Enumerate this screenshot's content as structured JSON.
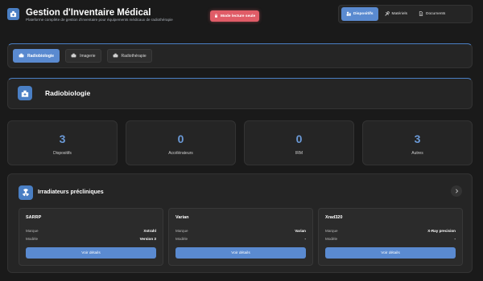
{
  "header": {
    "title": "Gestion d'Inventaire Médical",
    "subtitle": "Plateforme complète de gestion d'inventaire pour équipements médicaux de radiothérapie",
    "readonly_badge": "Mode lecture seule"
  },
  "topnav": {
    "tabs": [
      {
        "label": "Dispositifs",
        "icon": "devices-icon",
        "active": true
      },
      {
        "label": "Matériels",
        "icon": "tools-icon",
        "active": false
      },
      {
        "label": "Documents",
        "icon": "document-icon",
        "active": false
      }
    ]
  },
  "categories": [
    {
      "label": "Radiobiologie",
      "icon": "radiobiology-icon",
      "active": true
    },
    {
      "label": "Imagerie",
      "icon": "imaging-icon",
      "active": false
    },
    {
      "label": "Radiothérapie",
      "icon": "radiotherapy-icon",
      "active": false
    }
  ],
  "section": {
    "title": "Radiobiologie"
  },
  "stats": [
    {
      "value": "3",
      "label": "Dispositifs"
    },
    {
      "value": "0",
      "label": "Accélérateurs"
    },
    {
      "value": "0",
      "label": "IRM"
    },
    {
      "value": "3",
      "label": "Autres"
    }
  ],
  "group": {
    "title": "Irradiateurs précliniques",
    "cards": [
      {
        "name": "SARRP",
        "brand_label": "Marque",
        "brand": "Xstrahl",
        "model_label": "Modèle",
        "model": "Version 3",
        "button": "Voir détails"
      },
      {
        "name": "Varian",
        "brand_label": "Marque",
        "brand": "Varian",
        "model_label": "Modèle",
        "model": "-",
        "button": "Voir détails"
      },
      {
        "name": "Xrad320",
        "brand_label": "Marque",
        "brand": "X-Ray precision",
        "model_label": "Modèle",
        "model": "-",
        "button": "Voir détails"
      }
    ]
  },
  "colors": {
    "accent": "#5a8ad0",
    "background": "#1a1a1a",
    "panel": "#252525",
    "badge": "#e05c67",
    "stat_number": "#6b9ad8"
  }
}
